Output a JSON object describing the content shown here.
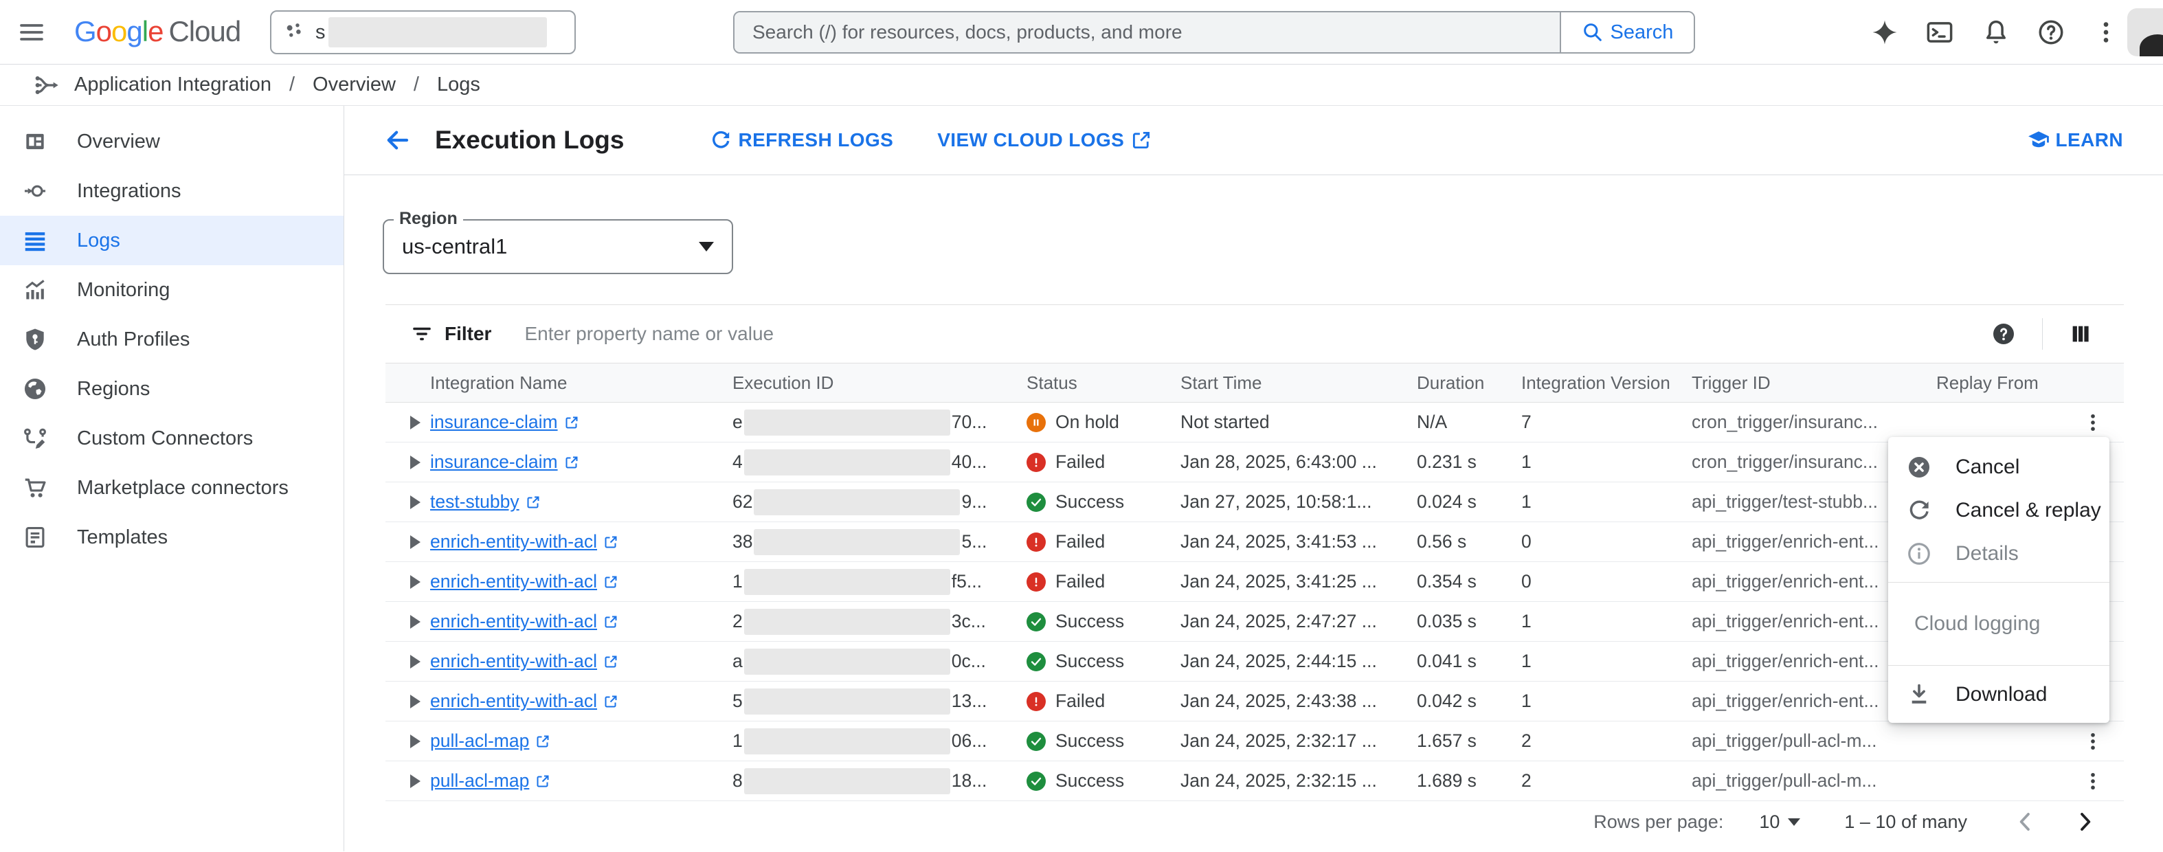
{
  "topbar": {
    "logo": {
      "google_letters": [
        "G",
        "o",
        "o",
        "g",
        "l",
        "e"
      ],
      "google_colors": [
        "#4285F4",
        "#EA4335",
        "#FBBC05",
        "#4285F4",
        "#34A853",
        "#EA4335"
      ],
      "cloud_text": "Cloud"
    },
    "project": {
      "prefix": "s"
    },
    "search": {
      "placeholder": "Search (/) for resources, docs, products, and more",
      "button": "Search"
    }
  },
  "breadcrumb": {
    "items": [
      "Application Integration",
      "Overview",
      "Logs"
    ],
    "separator": "/"
  },
  "sidebar": {
    "items": [
      {
        "label": "Overview",
        "icon": "overview-icon",
        "selected": false
      },
      {
        "label": "Integrations",
        "icon": "integrations-icon",
        "selected": false
      },
      {
        "label": "Logs",
        "icon": "logs-icon",
        "selected": true
      },
      {
        "label": "Monitoring",
        "icon": "monitoring-icon",
        "selected": false
      },
      {
        "label": "Auth Profiles",
        "icon": "auth-profiles-icon",
        "selected": false
      },
      {
        "label": "Regions",
        "icon": "regions-icon",
        "selected": false
      },
      {
        "label": "Custom Connectors",
        "icon": "custom-connectors-icon",
        "selected": false
      },
      {
        "label": "Marketplace connectors",
        "icon": "marketplace-icon",
        "selected": false
      },
      {
        "label": "Templates",
        "icon": "templates-icon",
        "selected": false
      }
    ]
  },
  "page": {
    "title": "Execution Logs",
    "refresh_label": "REFRESH LOGS",
    "view_cloud_logs_label": "VIEW CLOUD LOGS",
    "learn_label": "LEARN"
  },
  "region": {
    "label": "Region",
    "value": "us-central1"
  },
  "filter": {
    "label": "Filter",
    "placeholder": "Enter property name or value"
  },
  "table": {
    "columns": [
      "Integration Name",
      "Execution ID",
      "Status",
      "Start Time",
      "Duration",
      "Integration Version",
      "Trigger ID",
      "Replay From"
    ],
    "rows": [
      {
        "name": "insurance-claim",
        "exec_prefix": "e",
        "exec_suffix": "70...",
        "status": "On hold",
        "status_key": "on_hold",
        "start": "Not started",
        "duration": "N/A",
        "version": "7",
        "trigger": "cron_trigger/insuranc..."
      },
      {
        "name": "insurance-claim",
        "exec_prefix": "4",
        "exec_suffix": "40...",
        "status": "Failed",
        "status_key": "failed",
        "start": "Jan 28, 2025, 6:43:00 ...",
        "duration": "0.231 s",
        "version": "1",
        "trigger": "cron_trigger/insuranc..."
      },
      {
        "name": "test-stubby",
        "exec_prefix": "62",
        "exec_suffix": "9...",
        "status": "Success",
        "status_key": "success",
        "start": "Jan 27, 2025, 10:58:1...",
        "duration": "0.024 s",
        "version": "1",
        "trigger": "api_trigger/test-stubb..."
      },
      {
        "name": "enrich-entity-with-acl",
        "exec_prefix": "38",
        "exec_suffix": "5...",
        "status": "Failed",
        "status_key": "failed",
        "start": "Jan 24, 2025, 3:41:53 ...",
        "duration": "0.56 s",
        "version": "0",
        "trigger": "api_trigger/enrich-ent..."
      },
      {
        "name": "enrich-entity-with-acl",
        "exec_prefix": "1",
        "exec_suffix": "f5...",
        "status": "Failed",
        "status_key": "failed",
        "start": "Jan 24, 2025, 3:41:25 ...",
        "duration": "0.354 s",
        "version": "0",
        "trigger": "api_trigger/enrich-ent..."
      },
      {
        "name": "enrich-entity-with-acl",
        "exec_prefix": "2",
        "exec_suffix": "3c...",
        "status": "Success",
        "status_key": "success",
        "start": "Jan 24, 2025, 2:47:27 ...",
        "duration": "0.035 s",
        "version": "1",
        "trigger": "api_trigger/enrich-ent..."
      },
      {
        "name": "enrich-entity-with-acl",
        "exec_prefix": "a",
        "exec_suffix": "0c...",
        "status": "Success",
        "status_key": "success",
        "start": "Jan 24, 2025, 2:44:15 ...",
        "duration": "0.041 s",
        "version": "1",
        "trigger": "api_trigger/enrich-ent..."
      },
      {
        "name": "enrich-entity-with-acl",
        "exec_prefix": "5",
        "exec_suffix": "13...",
        "status": "Failed",
        "status_key": "failed",
        "start": "Jan 24, 2025, 2:43:38 ...",
        "duration": "0.042 s",
        "version": "1",
        "trigger": "api_trigger/enrich-ent..."
      },
      {
        "name": "pull-acl-map",
        "exec_prefix": "1",
        "exec_suffix": "06...",
        "status": "Success",
        "status_key": "success",
        "start": "Jan 24, 2025, 2:32:17 ...",
        "duration": "1.657 s",
        "version": "2",
        "trigger": "api_trigger/pull-acl-m..."
      },
      {
        "name": "pull-acl-map",
        "exec_prefix": "8",
        "exec_suffix": "18...",
        "status": "Success",
        "status_key": "success",
        "start": "Jan 24, 2025, 2:32:15 ...",
        "duration": "1.689 s",
        "version": "2",
        "trigger": "api_trigger/pull-acl-m..."
      }
    ]
  },
  "context_menu": {
    "items": [
      {
        "label": "Cancel",
        "icon": "cancel-icon",
        "disabled": false
      },
      {
        "label": "Cancel & replay",
        "icon": "replay-icon",
        "disabled": false
      },
      {
        "label": "Details",
        "icon": "info-icon",
        "disabled": true
      }
    ],
    "section_label": "Cloud logging",
    "download": {
      "label": "Download",
      "icon": "download-icon"
    }
  },
  "pagination": {
    "rows_per_page_label": "Rows per page:",
    "rows_per_page": "10",
    "range": "1 – 10 of many"
  },
  "colors": {
    "accent": "#1a73e8",
    "success": "#1e8e3e",
    "failed": "#d93025",
    "on_hold": "#e8710a"
  }
}
